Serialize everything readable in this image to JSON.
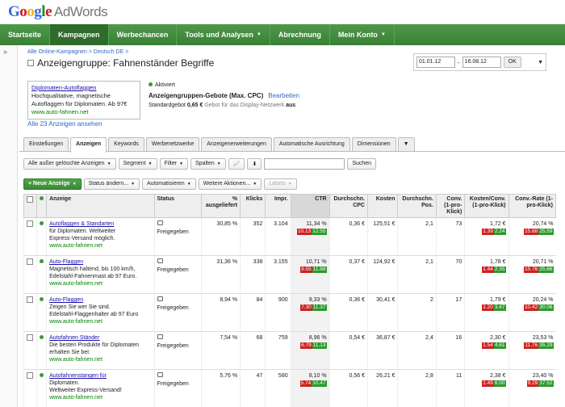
{
  "app": {
    "google": "Google",
    "product": "AdWords"
  },
  "nav": [
    {
      "label": "Startseite"
    },
    {
      "label": "Kampagnen",
      "active": true
    },
    {
      "label": "Werbechancen"
    },
    {
      "label": "Tools und Analysen",
      "caret": true
    },
    {
      "label": "Abrechnung"
    },
    {
      "label": "Mein Konto",
      "caret": true
    }
  ],
  "sidebar": {
    "toggle": "»"
  },
  "breadcrumb": "Alle Online-Kampagnen > Deutsch DE >",
  "page_title": "Anzeigengruppe: Fahnenständer Begriffe",
  "daterange": {
    "from": "01.01.12",
    "sep": "-",
    "to": "16.08.12",
    "ok": "OK",
    "dropdown": "▼"
  },
  "adpreview": {
    "title": "Diplomaten-Autoflaggen",
    "line1": "Hochqualitative, magnetische",
    "line2": "Autoflaggen für Diplomaten. Ab 97€",
    "url": "www.auto-fahnen.net"
  },
  "all_ads_link": "Alle 23 Anzeigen ansehen",
  "status": "Aktiviert",
  "bids": {
    "label": "Anzeigengruppen-Gebote (Max. CPC)",
    "edit": "Bearbeiten"
  },
  "standard": {
    "label": "Standardgebot",
    "value": "0,65 €",
    "display": "Gebot für das Display-Netzwerk",
    "display_val": "aus"
  },
  "tabs": [
    {
      "label": "Einstellungen"
    },
    {
      "label": "Anzeigen",
      "active": true
    },
    {
      "label": "Keywords"
    },
    {
      "label": "Werbenetzwerke"
    },
    {
      "label": "Anzeigenerweiterungen"
    },
    {
      "label": "Automatische Ausrichtung"
    },
    {
      "label": "Dimensionen"
    },
    {
      "label": "▼"
    }
  ],
  "toolbar1": {
    "filter_all": "Alle außer gelöschte Anzeigen",
    "segment": "Segment",
    "filter": "Filter",
    "columns": "Spalten",
    "search": "Suchen"
  },
  "toolbar2": {
    "new_ad": "+ Neue Anzeige",
    "status_change": "Status ändern...",
    "automate": "Automatisieren",
    "more": "Weitere Aktionen...",
    "labels": "Labels"
  },
  "columns": [
    "Anzeige",
    "Status",
    "% ausgeliefert",
    "Klicks",
    "Impr.",
    "CTR",
    "Durchschn. CPC",
    "Kosten",
    "Durchschn. Pos.",
    "Conv. (1-pro-Klick)",
    "Kosten/Conv. (1-pro-Klick)",
    "Conv.-Rate (1-pro-Klick)"
  ],
  "rows": [
    {
      "title": "Autoflaggen & Standarten",
      "l1": "für Diplomaten. Weltweiter",
      "l2": "Express-Versand möglich.",
      "url": "www.auto-fahnen.net",
      "status": "Freigegeben",
      "pct": "30,85 %",
      "clicks": "352",
      "impr": "3.104",
      "ctr": "11,34 %",
      "ctr_lo": "10.13",
      "ctr_hi": "12.55",
      "cpc": "0,36 €",
      "cost": "125,51 €",
      "pos": "2,1",
      "conv": "73",
      "cpconv": "1,72 €",
      "cpconv_lo": "1.39",
      "cpconv_hi": "2.24",
      "crate": "20,74 %",
      "crate_lo": "15.88",
      "crate_hi": "25.59"
    },
    {
      "title": "Auto-Flaggen",
      "l1": "Magnetisch haltend, bis 100 km/h,",
      "l2": "Edelstahl-Fahnenmast ab 97 Euro.",
      "url": "www.auto-fahnen.net",
      "status": "Freigegeben",
      "pct": "31,36 %",
      "clicks": "338",
      "impr": "3.155",
      "ctr": "10,71 %",
      "ctr_lo": "9.55",
      "ctr_hi": "11.88",
      "cpc": "0,37 €",
      "cost": "124,92 €",
      "pos": "2,1",
      "conv": "70",
      "cpconv": "1,78 €",
      "cpconv_lo": "1.44",
      "cpconv_hi": "2.35",
      "crate": "20,71 %",
      "crate_lo": "15.76",
      "crate_hi": "25.66"
    },
    {
      "title": "Auto-Flaggen",
      "l1": "Zeigen Sie wer Sie sind.",
      "l2": "Edelstahl-Flaggenhalter ab 97 Euro",
      "url": "www.auto-fahnen.net",
      "status": "Freigegeben",
      "pct": "8,94 %",
      "clicks": "84",
      "impr": "900",
      "ctr": "9,33 %",
      "ctr_lo": "7.30",
      "ctr_hi": "11.37",
      "cpc": "0,36 €",
      "cost": "30,41 €",
      "pos": "2",
      "conv": "17",
      "cpconv": "1,79 €",
      "cpconv_lo": "1.20",
      "cpconv_hi": "3.47",
      "crate": "20,24 %",
      "crate_lo": "10.42",
      "crate_hi": "30.06"
    },
    {
      "title": "Autofahnen Ständer",
      "l1": "Die besten Produkte für Diplomaten",
      "l2": "erhalten Sie bei:",
      "url": "www.auto-fahnen.net",
      "status": "Freigegeben",
      "pct": "7,54 %",
      "clicks": "68",
      "impr": "759",
      "ctr": "8,96 %",
      "ctr_lo": "6.79",
      "ctr_hi": "11.13",
      "cpc": "0,54 €",
      "cost": "36,87 €",
      "pos": "2,4",
      "conv": "16",
      "cpconv": "2,30 €",
      "cpconv_lo": "1.54",
      "cpconv_hi": "4.61",
      "crate": "23,53 %",
      "crate_lo": "11.76",
      "crate_hi": "35.29"
    },
    {
      "title": "Autofahnenstangen für",
      "l1": "Diplomaten.",
      "l2": "Weltweiter Express-Versand!",
      "url": "www.auto-fahnen.net",
      "status": "Freigegeben",
      "pct": "5,76 %",
      "clicks": "47",
      "impr": "580",
      "ctr": "8,10 %",
      "ctr_lo": "5.74",
      "ctr_hi": "10.47",
      "cpc": "0,56 €",
      "cost": "26,21 €",
      "pos": "2,8",
      "conv": "11",
      "cpconv": "2,38 €",
      "cpconv_lo": "1.49",
      "cpconv_hi": "6.00",
      "crate": "23,40 %",
      "crate_lo": "9.29",
      "crate_hi": "37.52"
    }
  ]
}
